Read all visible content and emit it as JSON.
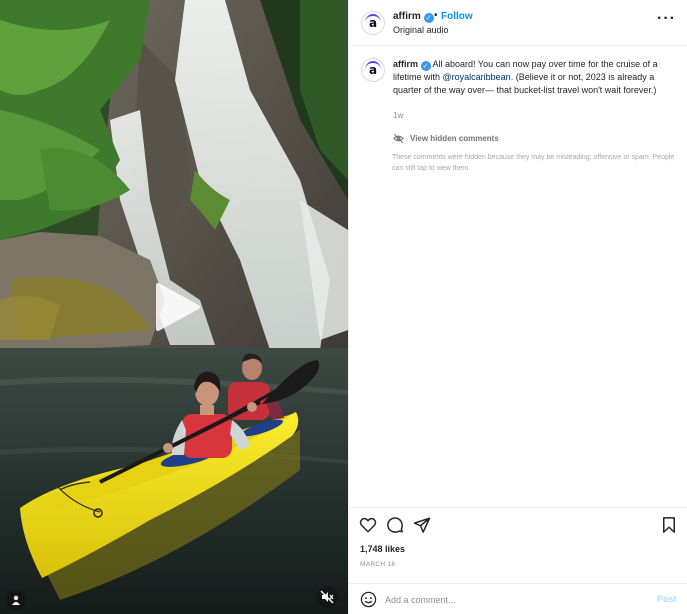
{
  "post": {
    "username": "affirm",
    "verified_mark": "✓",
    "separator": "•",
    "follow_label": "Follow",
    "audio_label": "Original audio",
    "more_label": "···"
  },
  "caption": {
    "username": "affirm",
    "text_before_mention": " All aboard! You can now pay over time for the cruise of a lifetime with ",
    "mention": "@royalcaribbean",
    "text_after_mention": ". (Believe it or not, 2023 is already a quarter of the way over— that bucket-list travel won't wait forever.)",
    "time_ago": "1w"
  },
  "hidden_comments": {
    "link_label": "View hidden comments",
    "note": "These comments were hidden because they may be misleading, offensive or spam. People can still tap to view them."
  },
  "stats": {
    "likes": "1,748 likes",
    "date": "MARCH 16"
  },
  "comment_box": {
    "placeholder": "Add a comment...",
    "post_label": "Post"
  },
  "colors": {
    "link_blue": "#0095f6",
    "post_disabled": "#b3dbff",
    "kayak_yellow": "#f4e21a",
    "life_vest_red": "#d9353c"
  },
  "icons": {
    "play": "play-icon",
    "user_tag": "user-tag-icon",
    "mute": "speaker-muted-icon",
    "like": "heart-icon",
    "comment": "comment-bubble-icon",
    "share": "paper-plane-icon",
    "save": "bookmark-icon",
    "emoji": "smiley-icon",
    "eye_slash": "eye-slash-icon"
  }
}
